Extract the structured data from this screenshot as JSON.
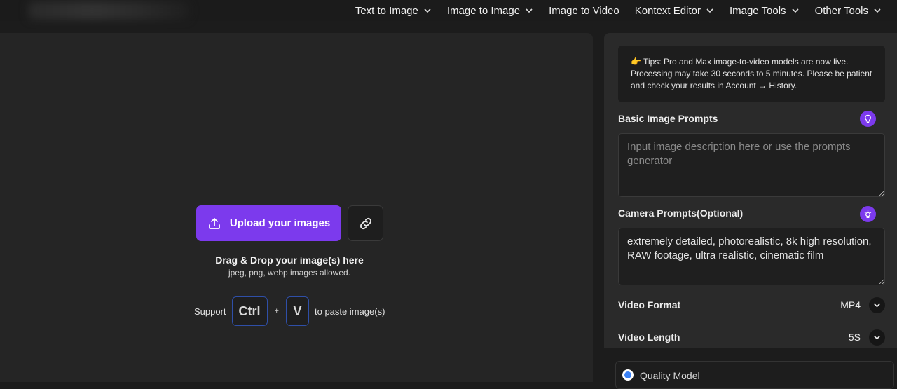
{
  "nav": {
    "items": [
      {
        "label": "Text to Image",
        "dropdown": true
      },
      {
        "label": "Image to Image",
        "dropdown": true
      },
      {
        "label": "Image to Video",
        "dropdown": false
      },
      {
        "label": "Kontext Editor",
        "dropdown": true
      },
      {
        "label": "Image Tools",
        "dropdown": true
      },
      {
        "label": "Other Tools",
        "dropdown": true
      }
    ]
  },
  "upload": {
    "button_label": "Upload your images",
    "upload_icon": "upload-icon",
    "link_icon": "link-icon",
    "drop_title": "Drag & Drop your image(s) here",
    "drop_sub": "jpeg, png, webp images allowed.",
    "paste_prefix": "Support",
    "key_ctrl": "Ctrl",
    "plus": "+",
    "key_v": "V",
    "paste_suffix": "to paste image(s)"
  },
  "settings": {
    "tips": "👉 Tips: Pro and Max image-to-video models are now live. Processing may take 30 seconds to 5 minutes. Please be patient and check your results in Account → History.",
    "basic_prompt_label": "Basic Image Prompts",
    "basic_prompt_placeholder": "Input image description here or use the prompts generator",
    "camera_prompt_label": "Camera Prompts(Optional)",
    "camera_prompt_value": "extremely detailed, photorealistic, 8k high resolution, RAW footage, ultra realistic, cinematic film",
    "video_format_label": "Video Format",
    "video_format_value": "MP4",
    "video_length_label": "Video Length",
    "video_length_value": "5S",
    "quality_model_label": "Quality Model"
  },
  "colors": {
    "accent": "#7c3aed",
    "key_border": "#2f4fa8",
    "radio": "#3b82f6"
  }
}
